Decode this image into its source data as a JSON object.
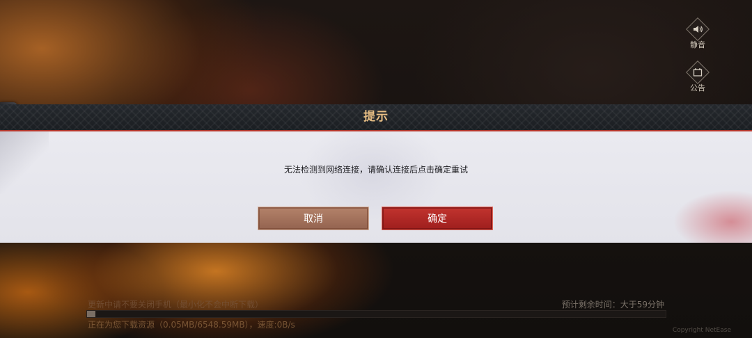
{
  "side": {
    "mute_label": "静音",
    "notice_label": "公告"
  },
  "dialog": {
    "title": "提示",
    "message": "无法检测到网络连接，请确认连接后点击确定重试",
    "cancel_label": "取消",
    "confirm_label": "确定"
  },
  "download": {
    "tip": "更新中请不要关闭手机（最小化不会中断下载）",
    "eta": "预计剩余时间：大于59分钟",
    "status": "正在为您下载资源（0.05MB/6548.59MB），速度:0B/s",
    "progress_fraction": 0.015,
    "version": "Copyright NetEase"
  },
  "colors": {
    "title": "#e7be84",
    "confirm_button": "#b0282a",
    "cancel_button": "#a2705b",
    "header_border": "#b4372c"
  },
  "icons": [
    "speaker-icon",
    "notice-icon",
    "chevron-right-icon"
  ]
}
